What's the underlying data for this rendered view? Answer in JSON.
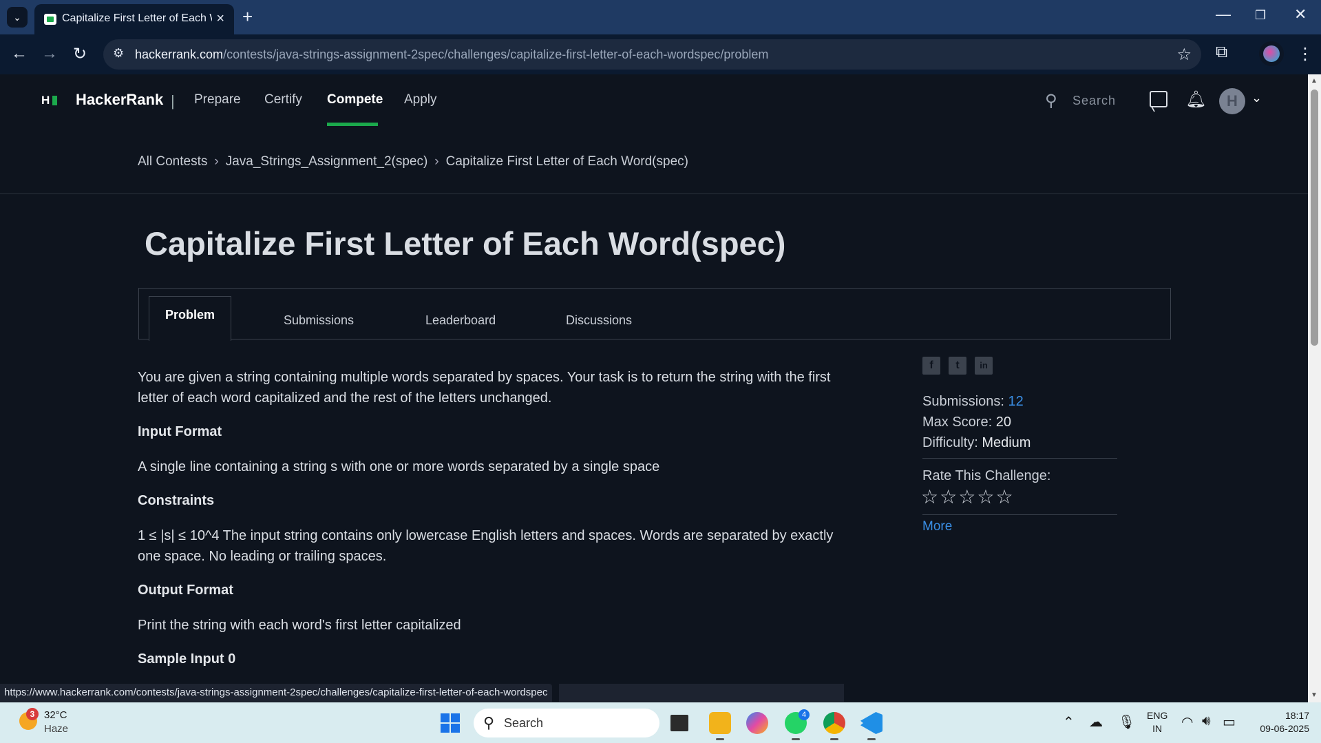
{
  "browser": {
    "tab_title": "Capitalize First Letter of Each W",
    "url_host": "hackerrank.com",
    "url_path": "/contests/java-strings-assignment-2spec/challenges/capitalize-first-letter-of-each-wordspec/problem",
    "status_url": "https://www.hackerrank.com/contests/java-strings-assignment-2spec/challenges/capitalize-first-letter-of-each-wordspec"
  },
  "header": {
    "brand": "HackerRank",
    "nav": [
      "Prepare",
      "Certify",
      "Compete",
      "Apply"
    ],
    "active_nav": "Compete",
    "search_placeholder": "Search",
    "avatar_letter": "H"
  },
  "breadcrumb": [
    "All Contests",
    "Java_Strings_Assignment_2(spec)",
    "Capitalize First Letter of Each Word(spec)"
  ],
  "page_title": "Capitalize First Letter of Each Word(spec)",
  "tabs": [
    "Problem",
    "Submissions",
    "Leaderboard",
    "Discussions"
  ],
  "problem": {
    "intro": "You are given a string containing multiple words separated by spaces. Your task is to return the string with the first letter of each word capitalized and the rest of the letters unchanged.",
    "input_format_heading": "Input Format",
    "input_format": "A single line containing a string s with one or more words separated by a single space",
    "constraints_heading": "Constraints",
    "constraints": "1 ≤ |s| ≤ 10^4 The input string contains only lowercase English letters and spaces. Words are separated by exactly one space. No leading or trailing spaces.",
    "output_format_heading": "Output Format",
    "output_format": "Print the string with each word's first letter capitalized",
    "sample_input_heading": "Sample Input 0"
  },
  "sidebar": {
    "submissions_label": "Submissions:",
    "submissions_value": "12",
    "max_score_label": "Max Score:",
    "max_score_value": "20",
    "difficulty_label": "Difficulty:",
    "difficulty_value": "Medium",
    "rate_label": "Rate This Challenge:",
    "rating": 0,
    "more_label": "More"
  },
  "taskbar": {
    "weather_badge": "3",
    "temperature": "32°C",
    "weather": "Haze",
    "search_label": "Search",
    "whatsapp_badge": "4",
    "lang_1": "ENG",
    "lang_2": "IN",
    "time": "18:17",
    "date": "09-06-2025"
  },
  "colors": {
    "accent_green": "#1ba94c",
    "link_blue": "#3a8fe6",
    "page_bg": "#0e141e"
  }
}
